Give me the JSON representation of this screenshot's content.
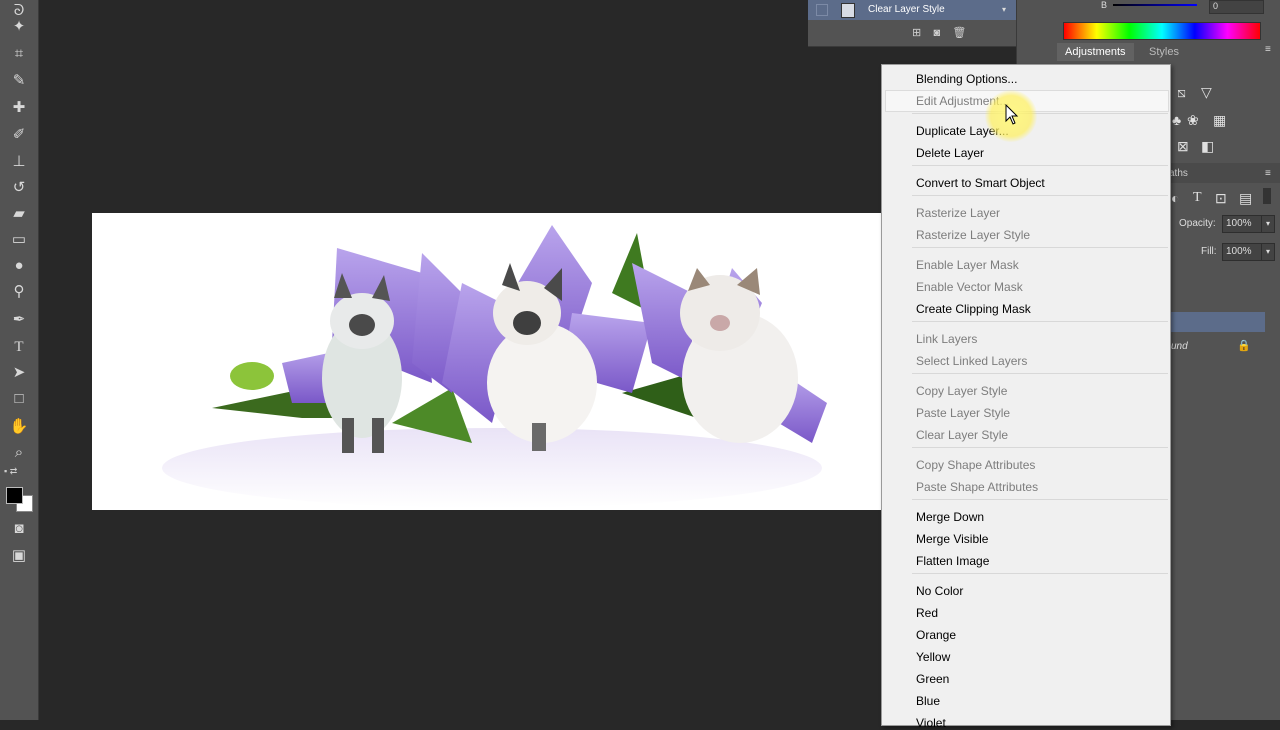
{
  "layers_panel": {
    "layer_name": "Clear Layer Style"
  },
  "color_panel": {
    "channel_label": "B",
    "channel_value": "0"
  },
  "panel_tabs": {
    "adjustments": "Adjustments",
    "styles": "Styles",
    "paths": "aths"
  },
  "layer_options": {
    "opacity_label": "Opacity:",
    "opacity_value": "100%",
    "fill_label": "Fill:",
    "fill_value": "100%",
    "background_label": "und"
  },
  "context_menu": {
    "items": [
      {
        "label": "Blending Options...",
        "enabled": true
      },
      {
        "label": "Edit Adjustment...",
        "enabled": false
      },
      {
        "label": "Duplicate Layer...",
        "enabled": true
      },
      {
        "label": "Delete Layer",
        "enabled": true
      },
      {
        "label": "Convert to Smart Object",
        "enabled": true
      },
      {
        "label": "Rasterize Layer",
        "enabled": false
      },
      {
        "label": "Rasterize Layer Style",
        "enabled": false
      },
      {
        "label": "Enable Layer Mask",
        "enabled": false
      },
      {
        "label": "Enable Vector Mask",
        "enabled": false
      },
      {
        "label": "Create Clipping Mask",
        "enabled": true
      },
      {
        "label": "Link Layers",
        "enabled": false
      },
      {
        "label": "Select Linked Layers",
        "enabled": false
      },
      {
        "label": "Copy Layer Style",
        "enabled": false
      },
      {
        "label": "Paste Layer Style",
        "enabled": false
      },
      {
        "label": "Clear Layer Style",
        "enabled": false
      },
      {
        "label": "Copy Shape Attributes",
        "enabled": false
      },
      {
        "label": "Paste Shape Attributes",
        "enabled": false
      },
      {
        "label": "Merge Down",
        "enabled": true
      },
      {
        "label": "Merge Visible",
        "enabled": true
      },
      {
        "label": "Flatten Image",
        "enabled": true
      },
      {
        "label": "No Color",
        "enabled": true
      },
      {
        "label": "Red",
        "enabled": true
      },
      {
        "label": "Orange",
        "enabled": true
      },
      {
        "label": "Yellow",
        "enabled": true
      },
      {
        "label": "Green",
        "enabled": true
      },
      {
        "label": "Blue",
        "enabled": true
      },
      {
        "label": "Violet",
        "enabled": true
      }
    ]
  },
  "colors": {
    "workspace": "#282828",
    "panel": "#535353",
    "menu_bg": "#f0f0f0",
    "selected_layer": "#5c6c8a",
    "petal": "#8c6cd8"
  }
}
